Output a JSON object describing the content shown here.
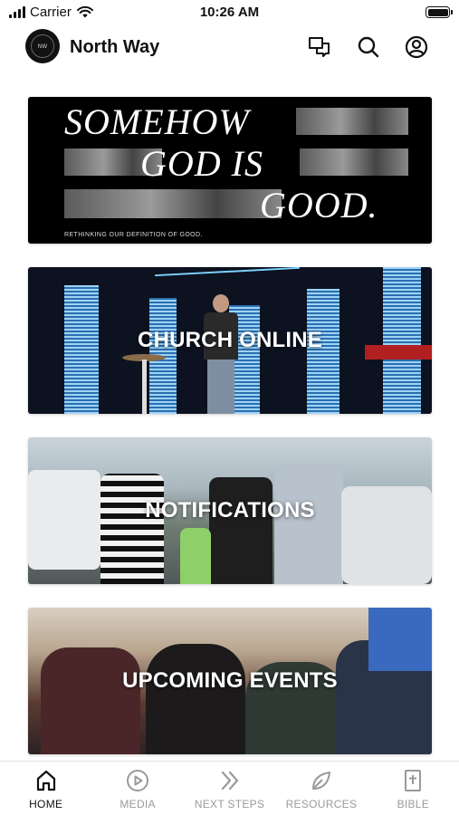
{
  "status_bar": {
    "carrier": "Carrier",
    "time": "10:26 AM"
  },
  "header": {
    "logo_text": "NW",
    "title": "North Way"
  },
  "banner": {
    "line1": "SOMEHOW",
    "line2": "GOD IS",
    "line3": "GOOD.",
    "subtitle": "RETHINKING OUR DEFINITION OF GOOD."
  },
  "cards": [
    {
      "label": "CHURCH ONLINE"
    },
    {
      "label": "NOTIFICATIONS"
    },
    {
      "label": "UPCOMING EVENTS"
    }
  ],
  "tabs": [
    {
      "label": "HOME",
      "icon": "home-icon",
      "active": true
    },
    {
      "label": "MEDIA",
      "icon": "play-circle-icon",
      "active": false
    },
    {
      "label": "NEXT STEPS",
      "icon": "double-chevron-icon",
      "active": false
    },
    {
      "label": "RESOURCES",
      "icon": "leaf-icon",
      "active": false
    },
    {
      "label": "BIBLE",
      "icon": "bible-icon",
      "active": false
    }
  ],
  "colors": {
    "active_tab": "#111111",
    "inactive_tab": "#9a9a9a",
    "background": "#ffffff"
  }
}
